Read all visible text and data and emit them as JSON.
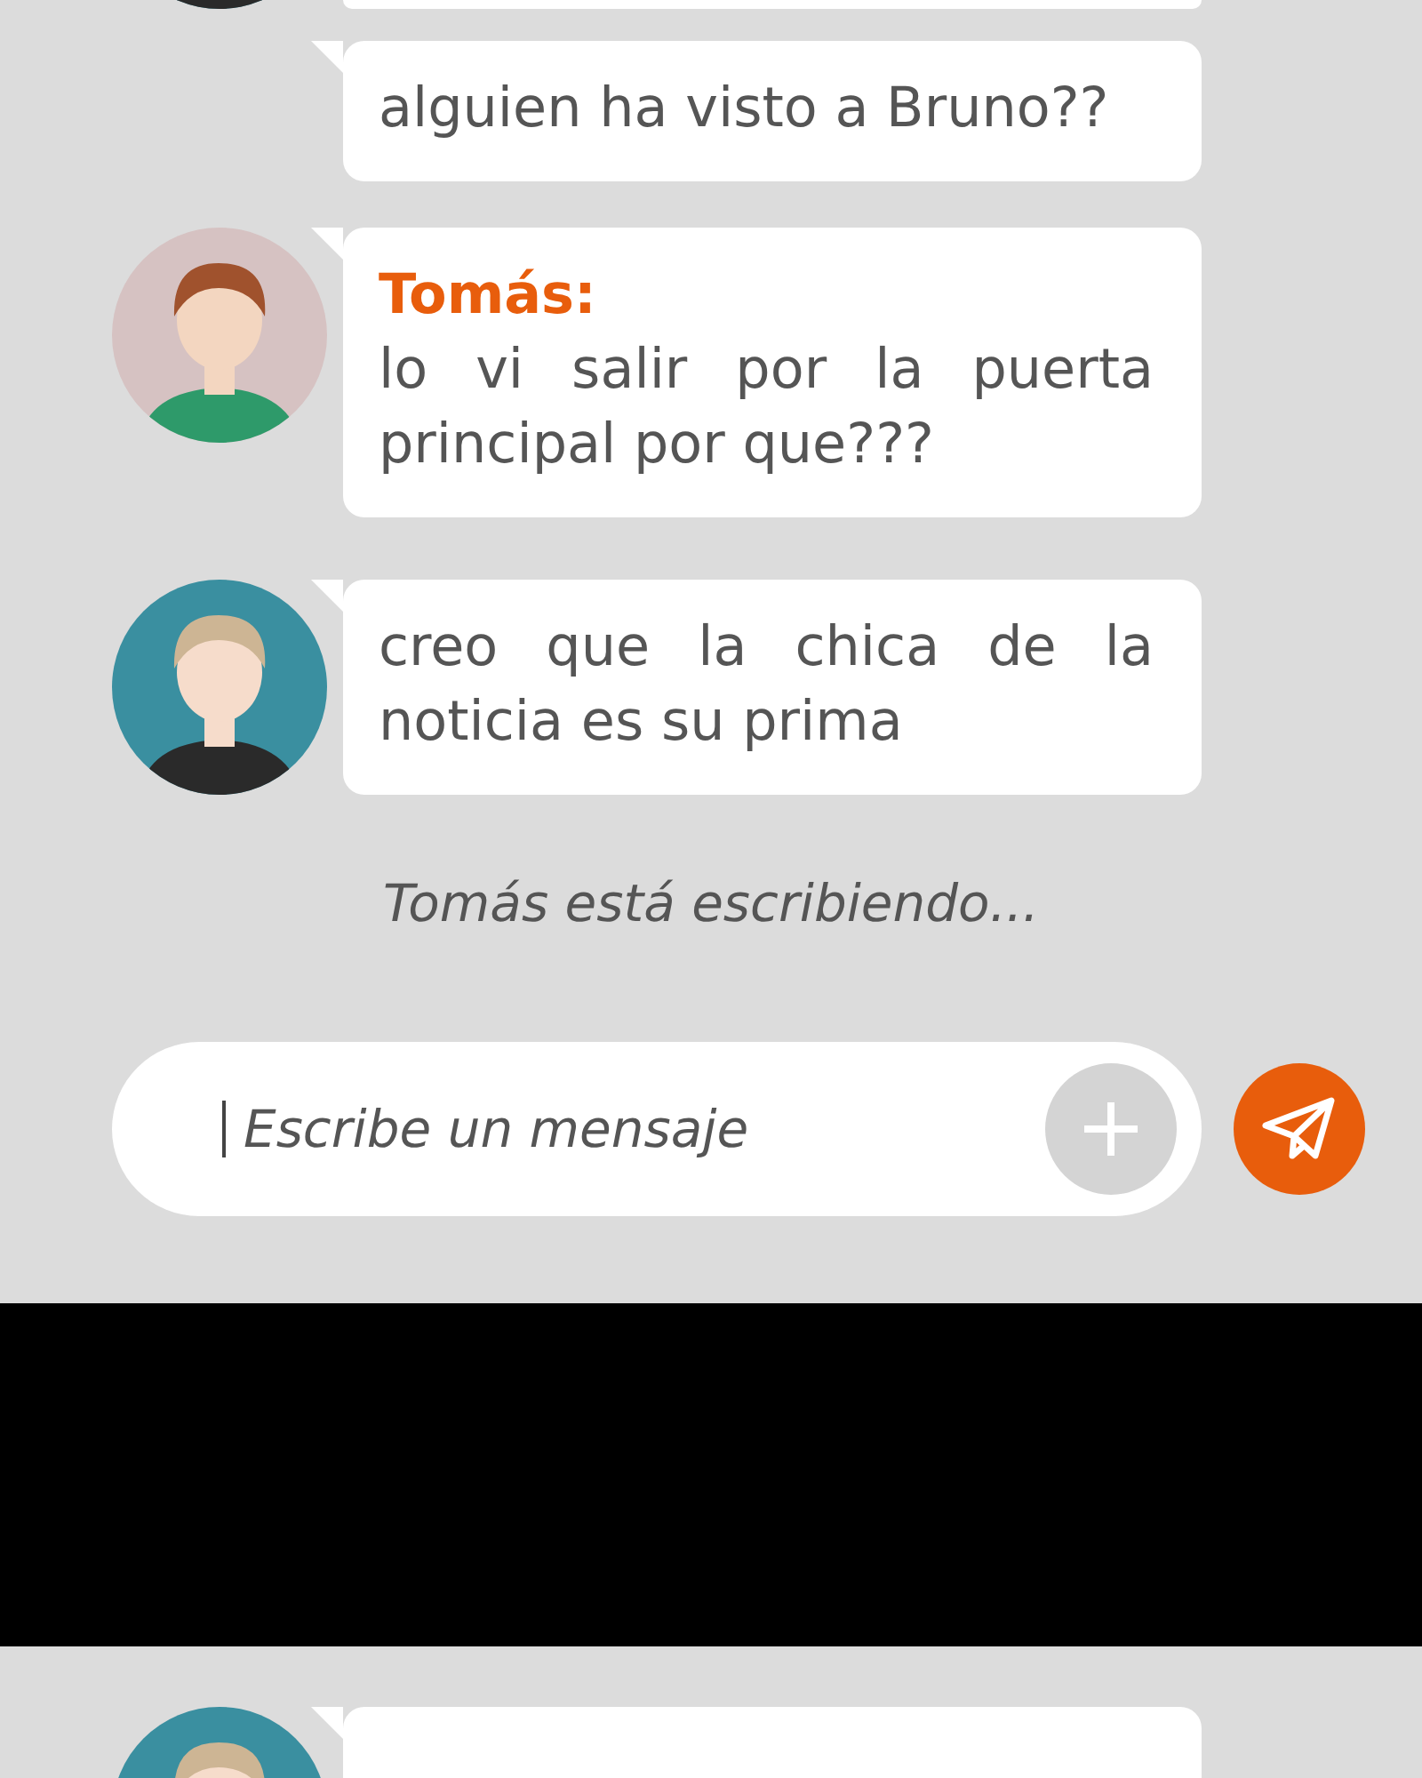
{
  "messages": [
    {
      "text": "alguien ha visto a Bruno??",
      "avatar": false
    },
    {
      "sender": "Tomás:",
      "text": "lo vi salir por la puerta principal por que???",
      "avatar": true
    },
    {
      "text": "creo que la chica de la noticia es su prima",
      "avatar": true
    }
  ],
  "typing_indicator": "Tomás está escribiendo...",
  "composer": {
    "placeholder": "Escribe un mensaje"
  }
}
